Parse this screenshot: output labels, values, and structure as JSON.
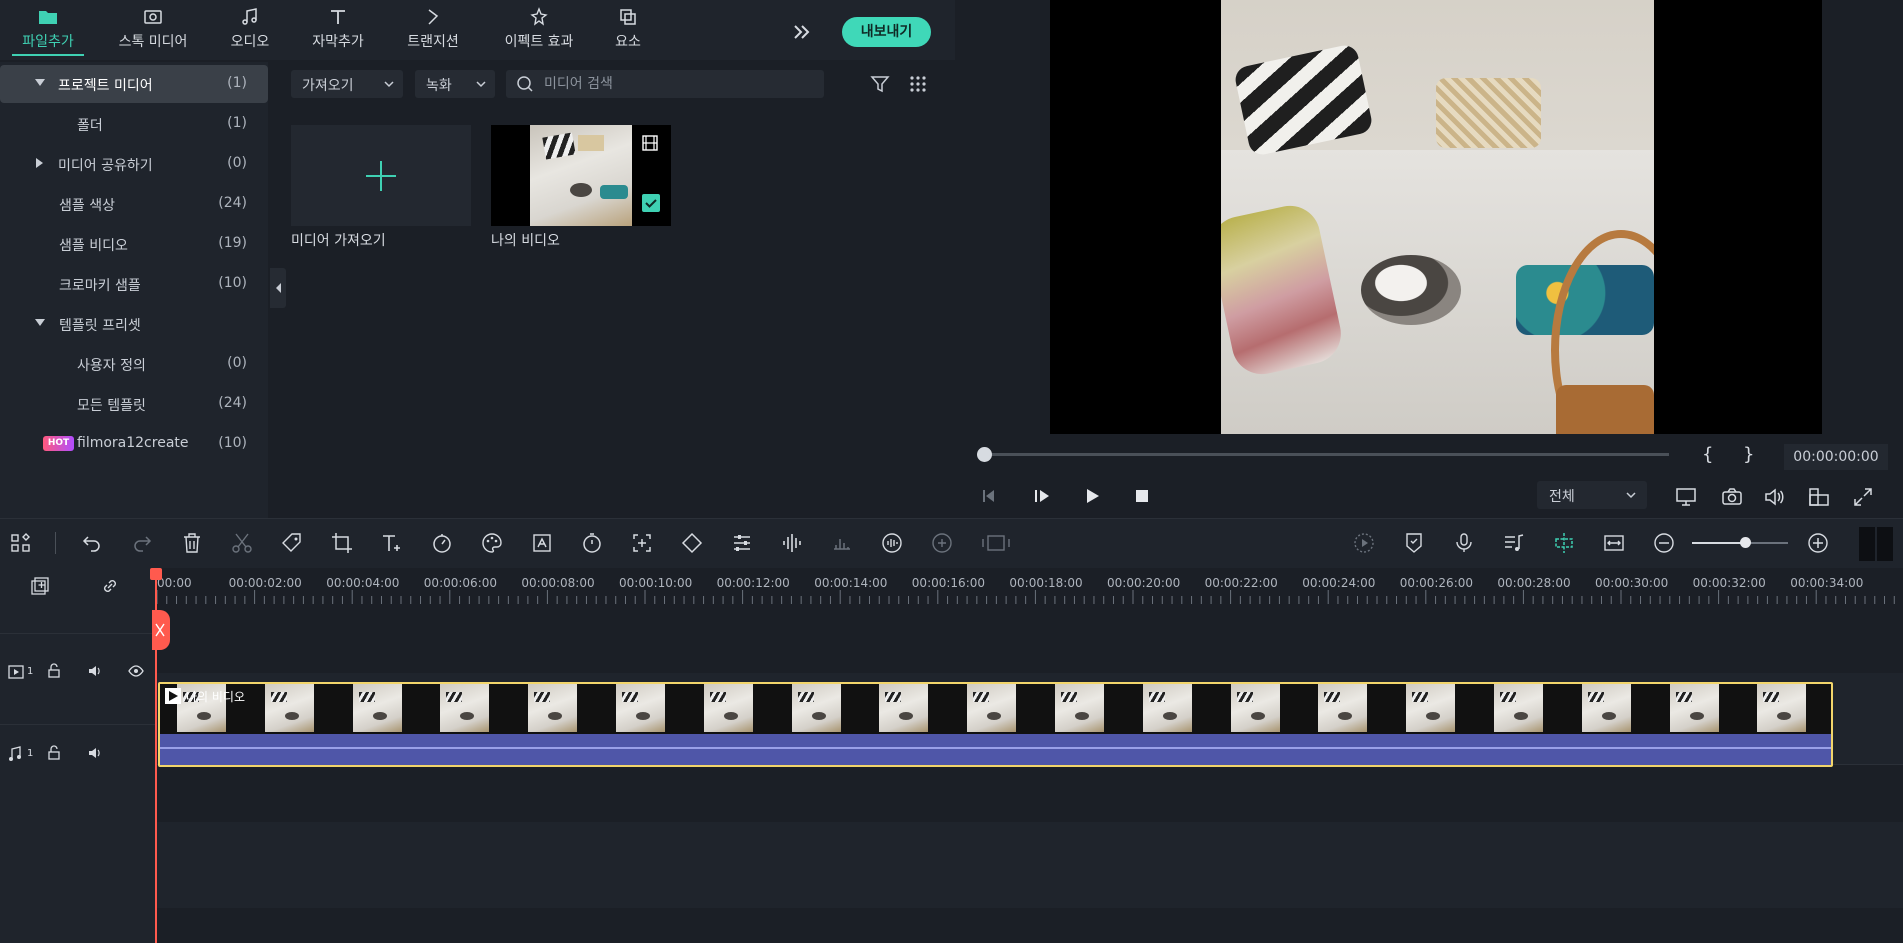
{
  "top_tabs": [
    {
      "label": "파일추가",
      "icon": "folder-icon",
      "active": true
    },
    {
      "label": "스톡 미디어",
      "icon": "image-icon"
    },
    {
      "label": "오디오",
      "icon": "music-note-icon"
    },
    {
      "label": "자막추가",
      "icon": "text-icon"
    },
    {
      "label": "트랜지션",
      "icon": "transition-icon"
    },
    {
      "label": "이펙트 효과",
      "icon": "effects-icon"
    },
    {
      "label": "요소",
      "icon": "elements-icon"
    }
  ],
  "export_label": "내보내기",
  "sidebar": {
    "items": [
      {
        "label": "프로젝트 미디어",
        "count": "(1)",
        "expanded": true,
        "selected": true
      },
      {
        "label": "폴더",
        "count": "(1)"
      },
      {
        "label": "미디어 공유하기",
        "count": "(0)",
        "expanded": false
      },
      {
        "label": "샘플 색상",
        "count": "(24)"
      },
      {
        "label": "샘플 비디오",
        "count": "(19)"
      },
      {
        "label": "크로마키 샘플",
        "count": "(10)"
      },
      {
        "label": "템플릿 프리셋",
        "count": "",
        "expanded": true
      },
      {
        "label": "사용자 정의",
        "count": "(0)"
      },
      {
        "label": "모든 템플릿",
        "count": "(24)"
      },
      {
        "label": "filmora12create",
        "count": "(10)",
        "badge": "HOT"
      }
    ]
  },
  "media": {
    "import_dropdown": "가져오기",
    "record_dropdown": "녹화",
    "search_placeholder": "미디어 검색",
    "items": [
      {
        "name": "미디어 가져오기"
      },
      {
        "name": "나의 비디오"
      }
    ]
  },
  "preview": {
    "timecode": "00:00:00:00",
    "mark_in": "{",
    "mark_out": "}",
    "quality": "전체",
    "progress": 0
  },
  "timeline": {
    "ruler_labels": [
      "00:00",
      "00:00:02:00",
      "00:00:04:00",
      "00:00:06:00",
      "00:00:08:00",
      "00:00:10:00",
      "00:00:12:00",
      "00:00:14:00",
      "00:00:16:00",
      "00:00:18:00",
      "00:00:20:00",
      "00:00:22:00",
      "00:00:24:00",
      "00:00:26:00",
      "00:00:28:00",
      "00:00:30:00",
      "00:00:32:00",
      "00:00:34:00"
    ],
    "clip_label": "나의 비디오",
    "video_track_num": "1",
    "audio_track_num": "1",
    "zoom_level": 0.55
  },
  "colors": {
    "accent": "#3fd1b3",
    "playhead": "#ff5a4e",
    "clip_border": "#f2d56b",
    "audio_wave": "#4f56a8"
  }
}
